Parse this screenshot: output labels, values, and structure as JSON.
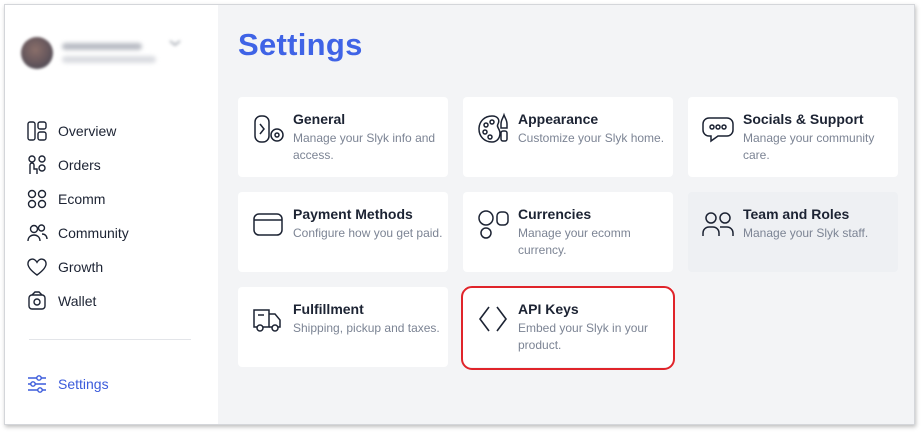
{
  "profile": {
    "name": "",
    "subtitle": ""
  },
  "sidebar": {
    "items": [
      {
        "label": "Overview",
        "icon": "overview-icon"
      },
      {
        "label": "Orders",
        "icon": "orders-icon"
      },
      {
        "label": "Ecomm",
        "icon": "ecomm-icon"
      },
      {
        "label": "Community",
        "icon": "community-icon"
      },
      {
        "label": "Growth",
        "icon": "growth-icon"
      },
      {
        "label": "Wallet",
        "icon": "wallet-icon"
      }
    ],
    "settings": {
      "label": "Settings",
      "icon": "settings-sliders-icon"
    }
  },
  "page": {
    "title": "Settings"
  },
  "cards": [
    {
      "title": "General",
      "desc": "Manage your Slyk info and access.",
      "icon": "general-icon"
    },
    {
      "title": "Appearance",
      "desc": "Customize your Slyk home.",
      "icon": "appearance-palette-icon"
    },
    {
      "title": "Socials & Support",
      "desc": "Manage your community care.",
      "icon": "chat-bubble-icon"
    },
    {
      "title": "Payment Methods",
      "desc": "Configure how you get paid.",
      "icon": "payment-card-icon"
    },
    {
      "title": "Currencies",
      "desc": "Manage your ecomm currency.",
      "icon": "currencies-icon"
    },
    {
      "title": "Team and Roles",
      "desc": "Manage your Slyk staff.",
      "icon": "team-icon"
    },
    {
      "title": "Fulfillment",
      "desc": "Shipping, pickup and taxes.",
      "icon": "delivery-truck-icon"
    },
    {
      "title": "API Keys",
      "desc": "Embed your Slyk in your product.",
      "icon": "code-brackets-icon"
    }
  ],
  "colors": {
    "accent": "#3f63e6",
    "highlight": "#e0242a",
    "main_bg": "#f3f4f6"
  }
}
